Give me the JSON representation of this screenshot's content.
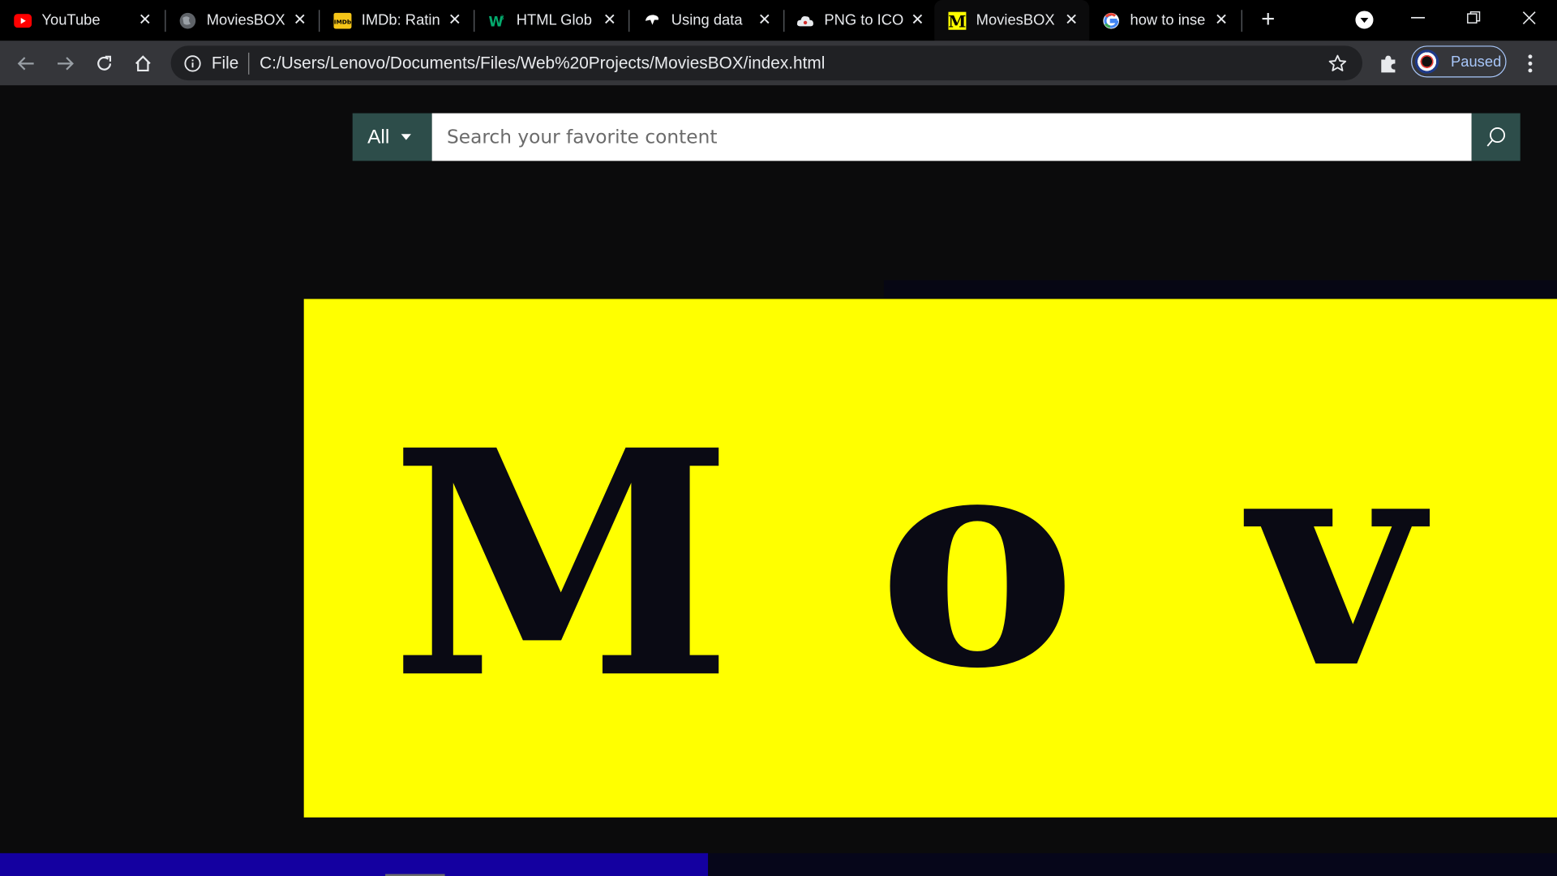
{
  "browser": {
    "tabs": [
      {
        "title": "YouTube",
        "favicon": "youtube-icon",
        "active": false
      },
      {
        "title": "MoviesBOX",
        "favicon": "globe-icon",
        "active": false
      },
      {
        "title": "IMDb: Ratin",
        "favicon": "imdb-icon",
        "active": false
      },
      {
        "title": "HTML Glob",
        "favicon": "w3-icon",
        "active": false
      },
      {
        "title": "Using data",
        "favicon": "mdn-icon",
        "active": false
      },
      {
        "title": "PNG to ICO",
        "favicon": "cloud-icon",
        "active": false
      },
      {
        "title": "MoviesBOX",
        "favicon": "moviesbox-m-icon",
        "active": true
      },
      {
        "title": "how to inse",
        "favicon": "google-icon",
        "active": false
      }
    ],
    "address": {
      "scheme_label": "File",
      "url": "C:/Users/Lenovo/Documents/Files/Web%20Projects/MoviesBOX/index.html"
    },
    "profile": {
      "status": "Paused"
    }
  },
  "page": {
    "search": {
      "category": "All",
      "placeholder": "Search your favorite content",
      "value": ""
    },
    "hero": {
      "letters": [
        "M",
        "o",
        "v"
      ]
    },
    "progress": {
      "fraction": 0.455
    }
  },
  "colors": {
    "hero_bg": "#ffff00",
    "hero_text": "#0a0a14",
    "search_accent": "#2d4d4a",
    "progress_fill": "#1400a0"
  }
}
